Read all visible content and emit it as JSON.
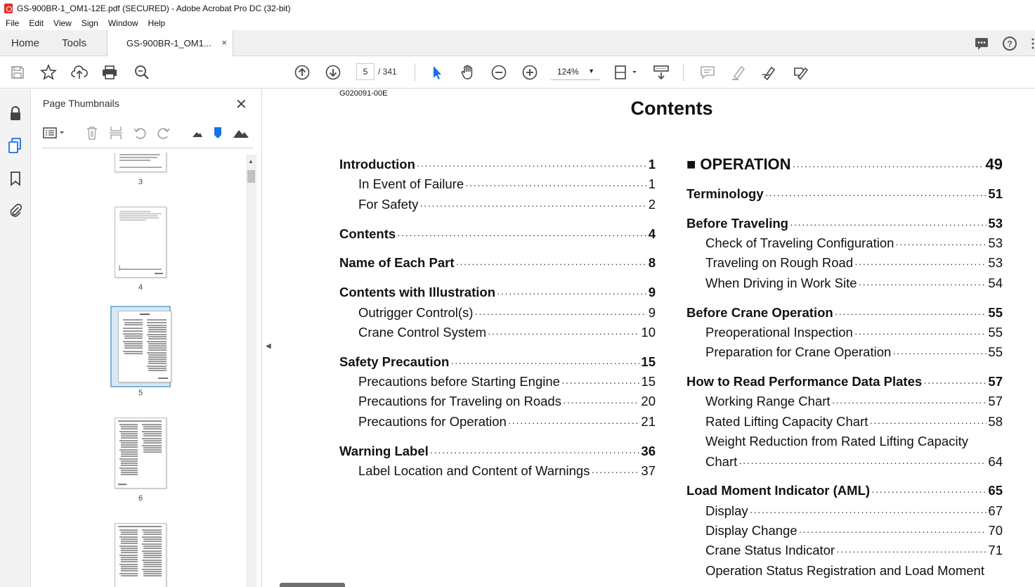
{
  "window": {
    "title": "GS-900BR-1_OM1-12E.pdf (SECURED) - Adobe Acrobat Pro DC (32-bit)"
  },
  "menu": [
    "File",
    "Edit",
    "View",
    "Sign",
    "Window",
    "Help"
  ],
  "tabs": {
    "home": "Home",
    "tools": "Tools",
    "document": "GS-900BR-1_OM1...",
    "close": "×"
  },
  "toolbar": {
    "current_page": "5",
    "total_pages": "/   341",
    "zoom": "124%"
  },
  "thumbnail_panel": {
    "title": "Page Thumbnails",
    "close": "✕",
    "pages": [
      {
        "label": "3"
      },
      {
        "label": "4"
      },
      {
        "label": "5",
        "selected": true
      },
      {
        "label": "6"
      }
    ]
  },
  "document": {
    "doc_id": "G020091-00E",
    "heading": "Contents",
    "left_column": [
      {
        "label": "Introduction",
        "page": "1",
        "level": "major"
      },
      {
        "label": "In Event of Failure",
        "page": "1",
        "level": "minor"
      },
      {
        "label": "For Safety",
        "page": "2",
        "level": "minor"
      },
      {
        "label": "Contents",
        "page": "4",
        "level": "major"
      },
      {
        "label": "Name of Each Part",
        "page": "8",
        "level": "major"
      },
      {
        "label": "Contents with Illustration",
        "page": "9",
        "level": "major"
      },
      {
        "label": "Outrigger Control(s)",
        "page": "9",
        "level": "minor"
      },
      {
        "label": "Crane Control System",
        "page": "10",
        "level": "minor"
      },
      {
        "label": "Safety Precaution",
        "page": "15",
        "level": "major"
      },
      {
        "label": "Precautions before Starting Engine",
        "page": "15",
        "level": "minor"
      },
      {
        "label": "Precautions for Traveling on Roads",
        "page": "20",
        "level": "minor"
      },
      {
        "label": "Precautions for Operation",
        "page": "21",
        "level": "minor"
      },
      {
        "label": "Warning Label",
        "page": "36",
        "level": "major"
      },
      {
        "label": "Label Location and Content of Warnings",
        "page": "37",
        "level": "minor"
      }
    ],
    "right_column": [
      {
        "label": "■ OPERATION",
        "page": "49",
        "level": "section"
      },
      {
        "label": "Terminology",
        "page": "51",
        "level": "major"
      },
      {
        "label": "Before Traveling",
        "page": "53",
        "level": "major"
      },
      {
        "label": "Check of Traveling Configuration",
        "page": "53",
        "level": "minor"
      },
      {
        "label": "Traveling on Rough Road",
        "page": "53",
        "level": "minor"
      },
      {
        "label": "When Driving in Work Site",
        "page": "54",
        "level": "minor"
      },
      {
        "label": "Before Crane Operation",
        "page": "55",
        "level": "major"
      },
      {
        "label": "Preoperational Inspection",
        "page": "55",
        "level": "minor"
      },
      {
        "label": "Preparation for Crane Operation",
        "page": "55",
        "level": "minor"
      },
      {
        "label": "How to Read Performance Data Plates",
        "page": "57",
        "level": "major"
      },
      {
        "label": "Working Range Chart",
        "page": "57",
        "level": "minor"
      },
      {
        "label": "Rated Lifting Capacity Chart",
        "page": "58",
        "level": "minor"
      },
      {
        "label": "Weight Reduction from Rated Lifting Capacity",
        "page": "",
        "level": "minor-plain"
      },
      {
        "label": "Chart",
        "page": "64",
        "level": "minor"
      },
      {
        "label": "Load Moment Indicator (AML)",
        "page": "65",
        "level": "major"
      },
      {
        "label": "Display",
        "page": "67",
        "level": "minor"
      },
      {
        "label": "Display Change",
        "page": "70",
        "level": "minor"
      },
      {
        "label": "Crane Status Indicator",
        "page": "71",
        "level": "minor"
      },
      {
        "label": "Operation Status Registration and Load Moment",
        "page": "",
        "level": "minor-plain"
      }
    ]
  },
  "colors": {
    "accent": "#1473e6",
    "selection": "#d7e8f5",
    "pdf_red": "#e0302a"
  }
}
